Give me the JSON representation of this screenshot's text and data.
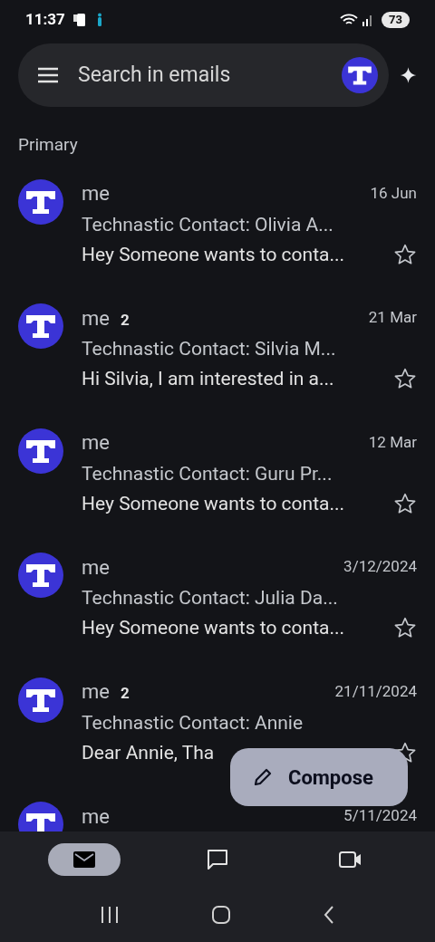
{
  "status_bar": {
    "time": "11:37",
    "battery": "73"
  },
  "search": {
    "placeholder": "Search in emails"
  },
  "section": "Primary",
  "emails": [
    {
      "sender": "me",
      "date": "16 Jun",
      "subject": "Technastic Contact: Olivia A...",
      "snippet": "Hey Someone wants to conta...",
      "starred": false
    },
    {
      "sender": "me",
      "count": "2",
      "date": "21 Mar",
      "subject": "Technastic Contact: Silvia M...",
      "snippet": "Hi Silvia, I am interested in a...",
      "starred": false
    },
    {
      "sender": "me",
      "date": "12 Mar",
      "subject": "Technastic Contact: Guru Pr...",
      "snippet": "Hey Someone wants to conta...",
      "starred": false
    },
    {
      "sender": "me",
      "date": "3/12/2024",
      "subject": "Technastic Contact: Julia Da...",
      "snippet": "Hey Someone wants to conta...",
      "starred": false
    },
    {
      "sender": "me",
      "count": "2",
      "date": "21/11/2024",
      "subject": "Technastic Contact: Annie",
      "snippet": "Dear Annie, Tha",
      "starred": false
    },
    {
      "sender": "me",
      "date": "5/11/2024"
    }
  ],
  "compose": {
    "label": "Compose"
  },
  "bottom_tabs": [
    {
      "kind": "mail",
      "selected": true
    },
    {
      "kind": "chat",
      "selected": false
    },
    {
      "kind": "meet",
      "selected": false
    }
  ]
}
